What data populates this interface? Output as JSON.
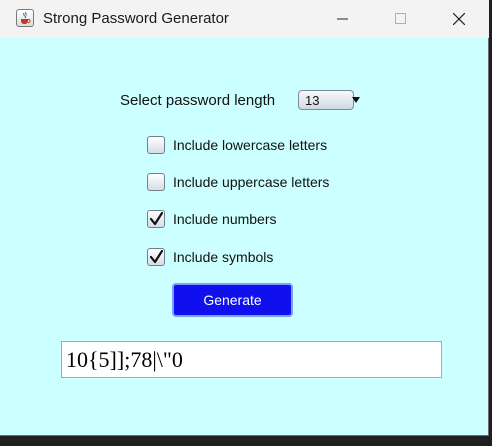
{
  "window": {
    "title": "Strong Password Generator",
    "icon": "java-cup-icon",
    "background_color": "#ccffff"
  },
  "controls": {
    "minimize_icon": "minimize-icon",
    "maximize_icon": "maximize-icon",
    "close_icon": "close-icon"
  },
  "length": {
    "label": "Select password length",
    "selected": "13"
  },
  "options": [
    {
      "label": "Include lowercase letters",
      "checked": false
    },
    {
      "label": "Include uppercase letters",
      "checked": false
    },
    {
      "label": "Include numbers",
      "checked": true
    },
    {
      "label": "Include symbols",
      "checked": true
    }
  ],
  "generate": {
    "label": "Generate",
    "color": "#1010ee"
  },
  "output": {
    "value": "10{5]];78|\\\"0"
  }
}
